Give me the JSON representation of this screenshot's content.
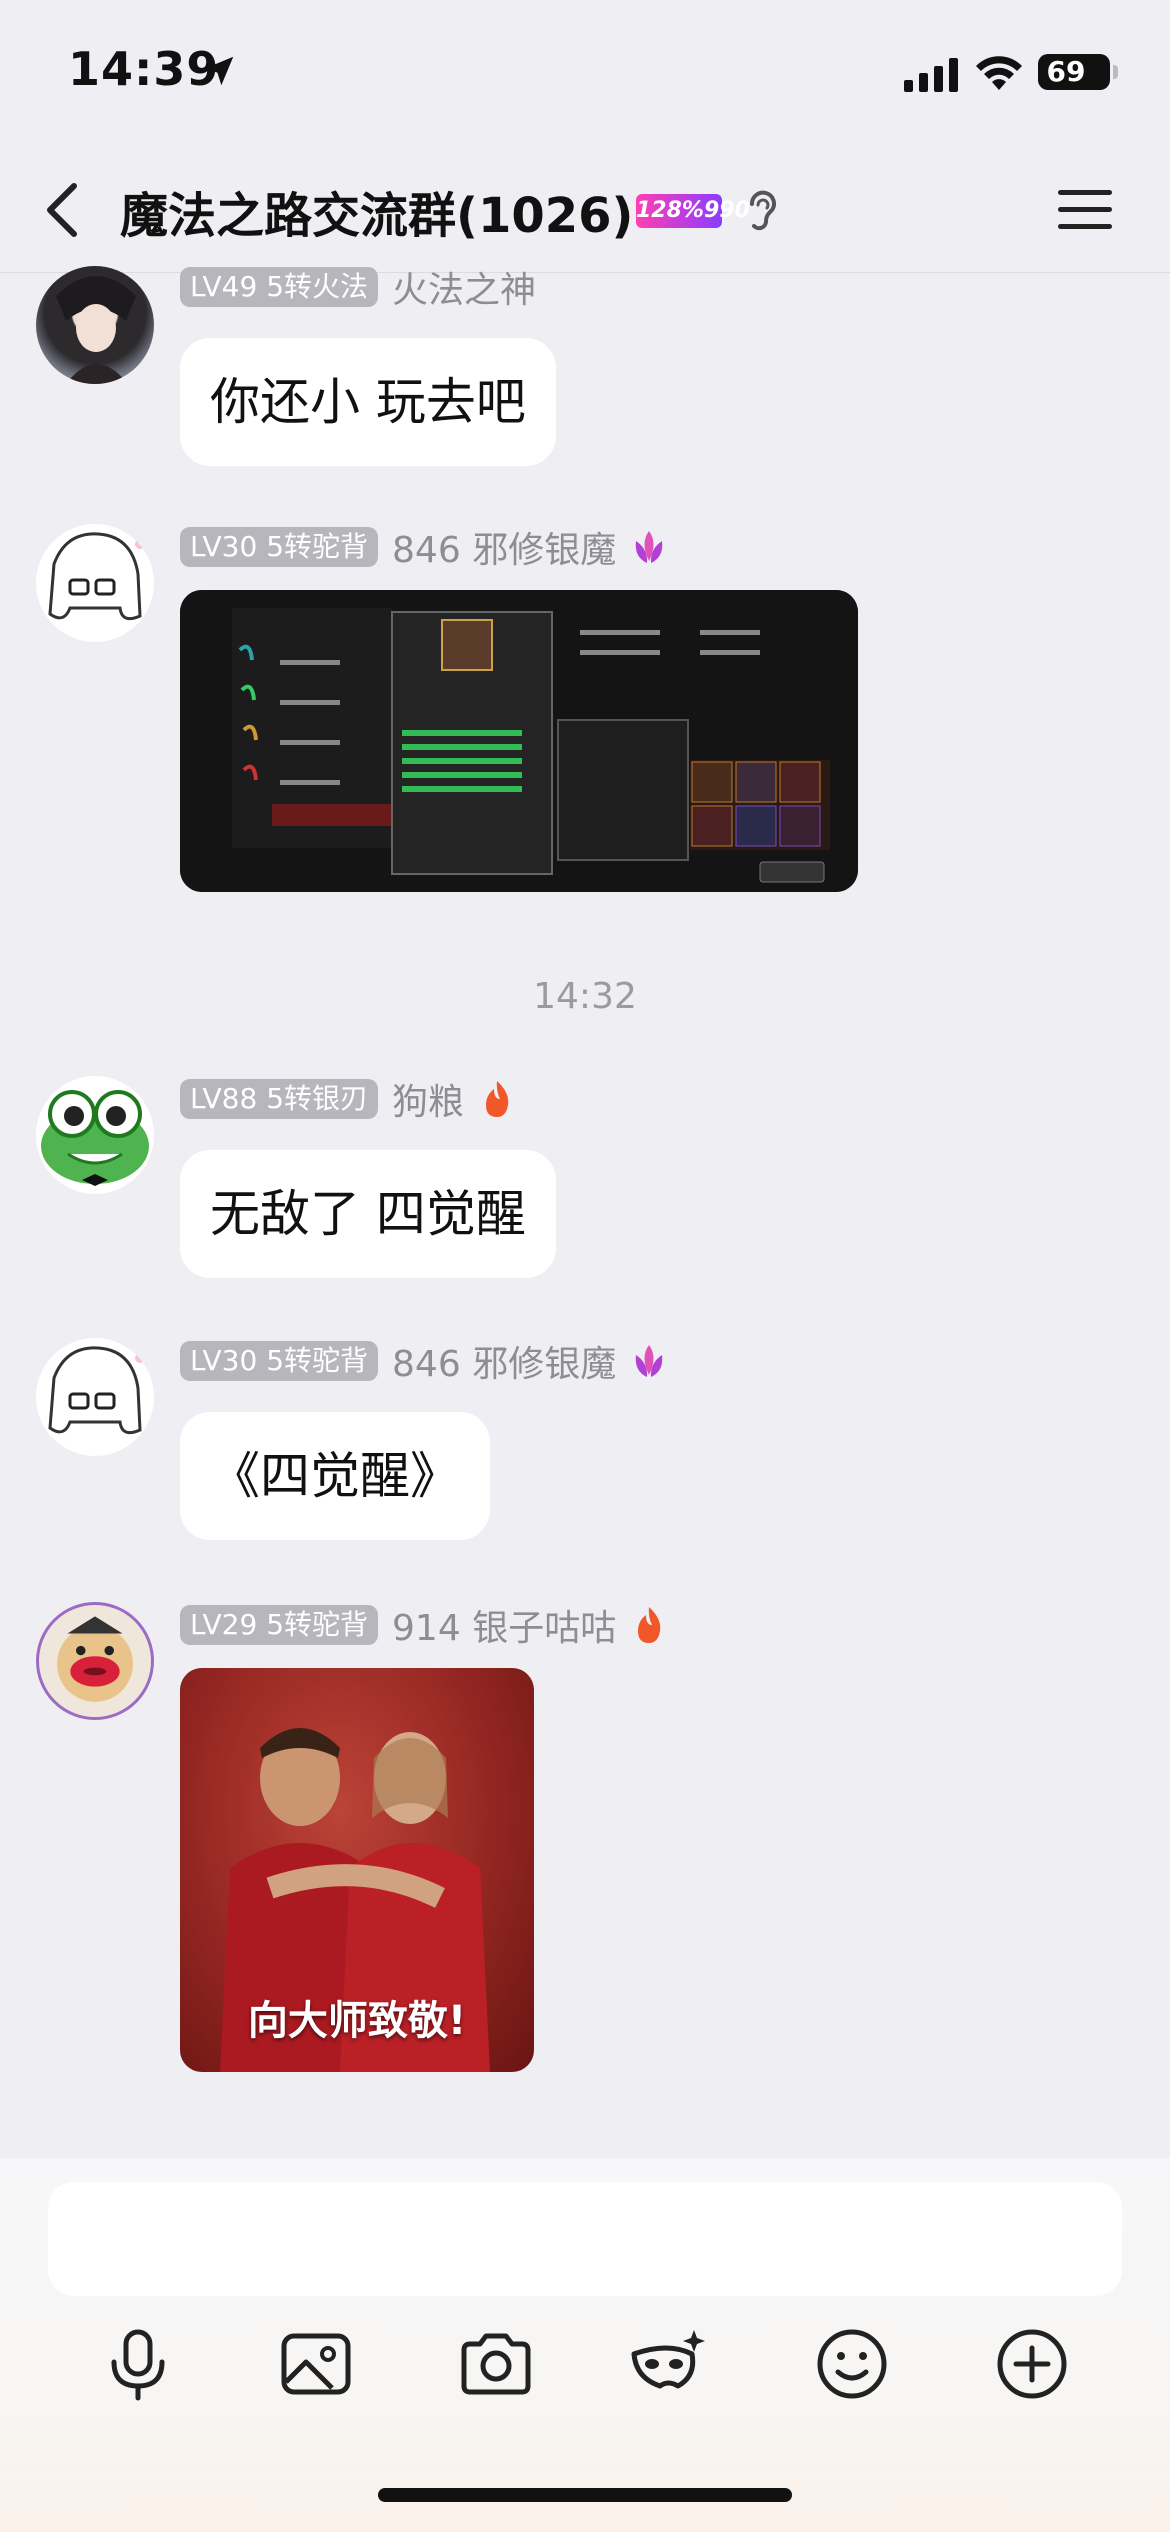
{
  "status_bar": {
    "time": "14:39",
    "battery": "69"
  },
  "header": {
    "title": "魔法之路交流群(1026)",
    "badge": "128%990"
  },
  "messages": [
    {
      "level": "LV49 5转火法",
      "nickname": "火法之神",
      "text": "你还小 玩去吧"
    },
    {
      "level": "LV30 5转驼背",
      "nickname": "846 邪修银魔",
      "type": "image",
      "image": "game-screenshot"
    },
    {
      "level": "LV88 5转银刃",
      "nickname": "狗粮",
      "text": "无敌了 四觉醒"
    },
    {
      "level": "LV30 5转驼背",
      "nickname": "846 邪修银魔",
      "text": "《四觉醒》"
    },
    {
      "level": "LV29 5转驼背",
      "nickname": "914 银子咕咕",
      "type": "image",
      "image_caption": "向大师致敬!"
    }
  ],
  "timestamp": "14:32",
  "toolbar": {
    "tools": [
      "microphone-icon",
      "image-icon",
      "camera-icon",
      "mask-icon",
      "emoji-icon",
      "plus-icon"
    ]
  },
  "colors": {
    "background": "#efeff3",
    "bubble": "#ffffff",
    "level_tag": "#b6b6bc",
    "nickname": "#8d8d94"
  }
}
